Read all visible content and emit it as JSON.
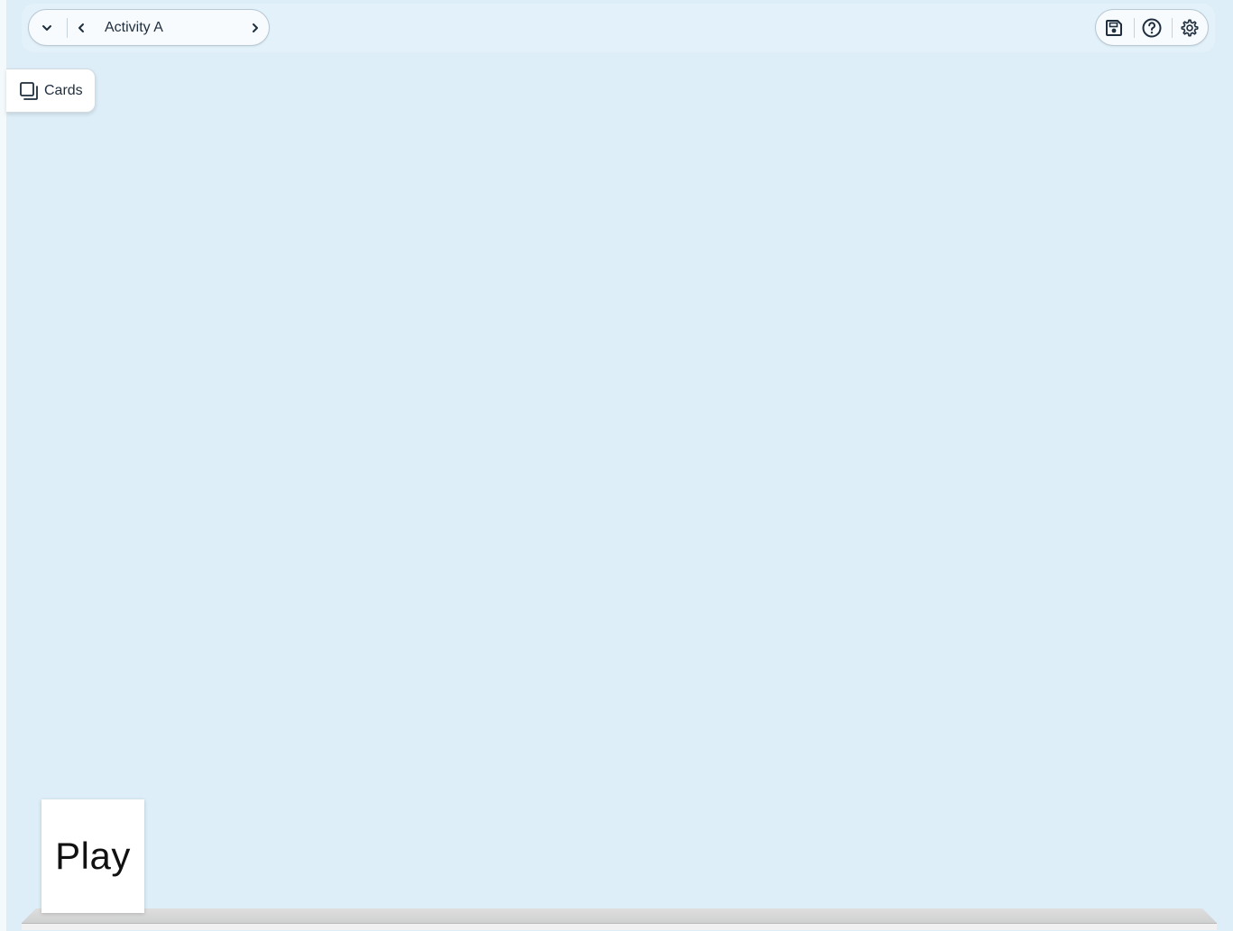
{
  "toolbar": {
    "activity_title": "Activity A",
    "icons": {
      "menu": "chevron-down-icon",
      "previous": "chevron-left-icon",
      "next": "chevron-right-icon",
      "save": "save-icon",
      "help": "help-icon",
      "settings": "gear-icon"
    }
  },
  "sidebar": {
    "cards_label": "Cards",
    "cards_icon": "cards-icon"
  },
  "canvas": {
    "card_text": "Play"
  },
  "colors": {
    "background": "#ddeef8",
    "text": "#1f2d3d"
  }
}
